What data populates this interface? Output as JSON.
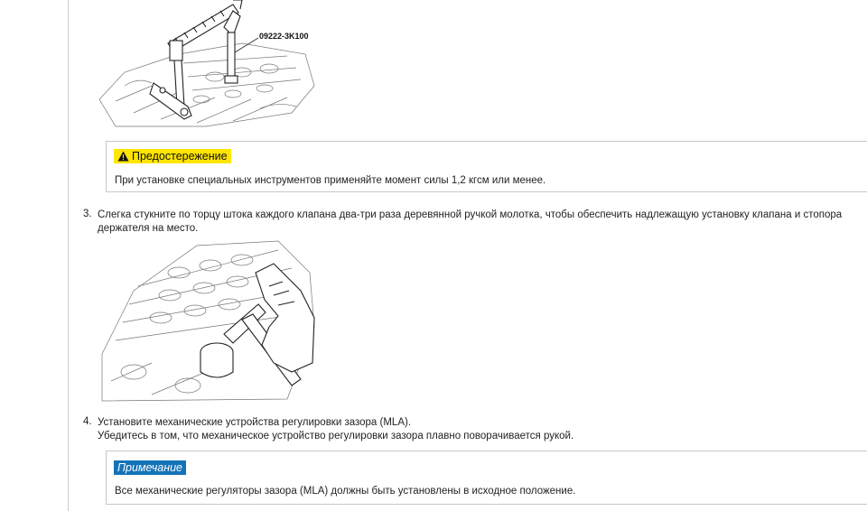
{
  "figure1": {
    "callout": "09222-3K100"
  },
  "caution": {
    "label": "Предостережение",
    "icon": "warning-triangle-icon",
    "text": "При установке специальных инструментов применяйте момент силы 1,2 кгсм или менее."
  },
  "steps": [
    {
      "number": "3.",
      "line1": "Слегка стукните по торцу штока каждого клапана два-три раза деревянной ручкой молотка, чтобы обеспечить надлежащую установку клапана и стопора",
      "line2": "держателя на место."
    },
    {
      "number": "4.",
      "line1": "Установите механические устройства регулировки зазора (MLA).",
      "line2": "Убедитесь в том, что механическое устройство регулировки зазора плавно поворачивается рукой."
    }
  ],
  "note": {
    "label": "Примечание",
    "text": "Все механические регуляторы зазора (MLA) должны быть установлены в исходное положение."
  },
  "colors": {
    "caution_bg": "#ffe500",
    "note_bg": "#1473b8",
    "border": "#c8c8c8"
  }
}
